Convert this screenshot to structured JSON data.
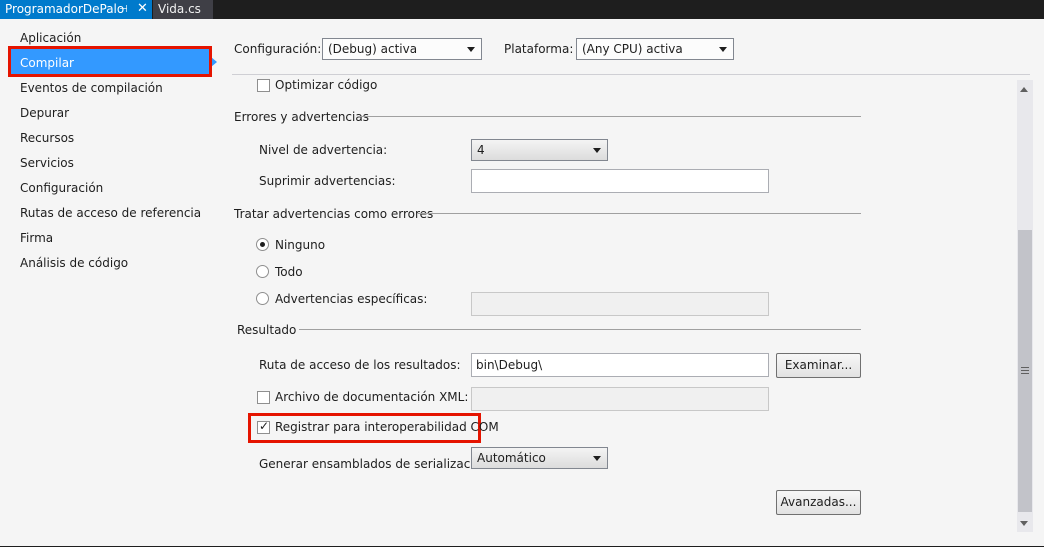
{
  "tabs": {
    "active_label": "ProgramadorDePalo",
    "pin_glyph": "⊣",
    "close_glyph": "✕",
    "second_label": "Vida.cs"
  },
  "sidebar": {
    "items": [
      {
        "label": "Aplicación"
      },
      {
        "label": "Compilar"
      },
      {
        "label": "Eventos de compilación"
      },
      {
        "label": "Depurar"
      },
      {
        "label": "Recursos"
      },
      {
        "label": "Servicios"
      },
      {
        "label": "Configuración"
      },
      {
        "label": "Rutas de acceso de referencia"
      },
      {
        "label": "Firma"
      },
      {
        "label": "Análisis de código"
      }
    ],
    "selected_index": 1
  },
  "toolbar": {
    "config_label": "Configuración:",
    "config_value": "(Debug) activa",
    "platform_label": "Plataforma:",
    "platform_value": "(Any CPU) activa"
  },
  "general": {
    "optimize_label": "Optimizar código"
  },
  "errors": {
    "header": "Errores y advertencias",
    "warning_level_label": "Nivel de advertencia:",
    "warning_level_value": "4",
    "suppress_label": "Suprimir advertencias:",
    "suppress_value": ""
  },
  "treat_warnings": {
    "header": "Tratar advertencias como errores",
    "option_none": "Ninguno",
    "option_all": "Todo",
    "option_specific": "Advertencias específicas:",
    "specific_value": ""
  },
  "output": {
    "header": "Resultado",
    "path_label": "Ruta de acceso de los resultados:",
    "path_value": "bin\\Debug\\",
    "browse_label": "Examinar...",
    "xml_doc_label": "Archivo de documentación XML:",
    "xml_doc_value": "",
    "com_label": "Registrar para interoperabilidad COM",
    "serialization_label": "Generar ensamblados de serialización:",
    "serialization_value": "Automático"
  },
  "advanced_label": "Avanzadas...",
  "colors": {
    "accent": "#007acc",
    "selection": "#3399ff",
    "highlight_box": "#e51400",
    "tab_strip": "#1e1e1e",
    "background": "#f5f5f5"
  }
}
